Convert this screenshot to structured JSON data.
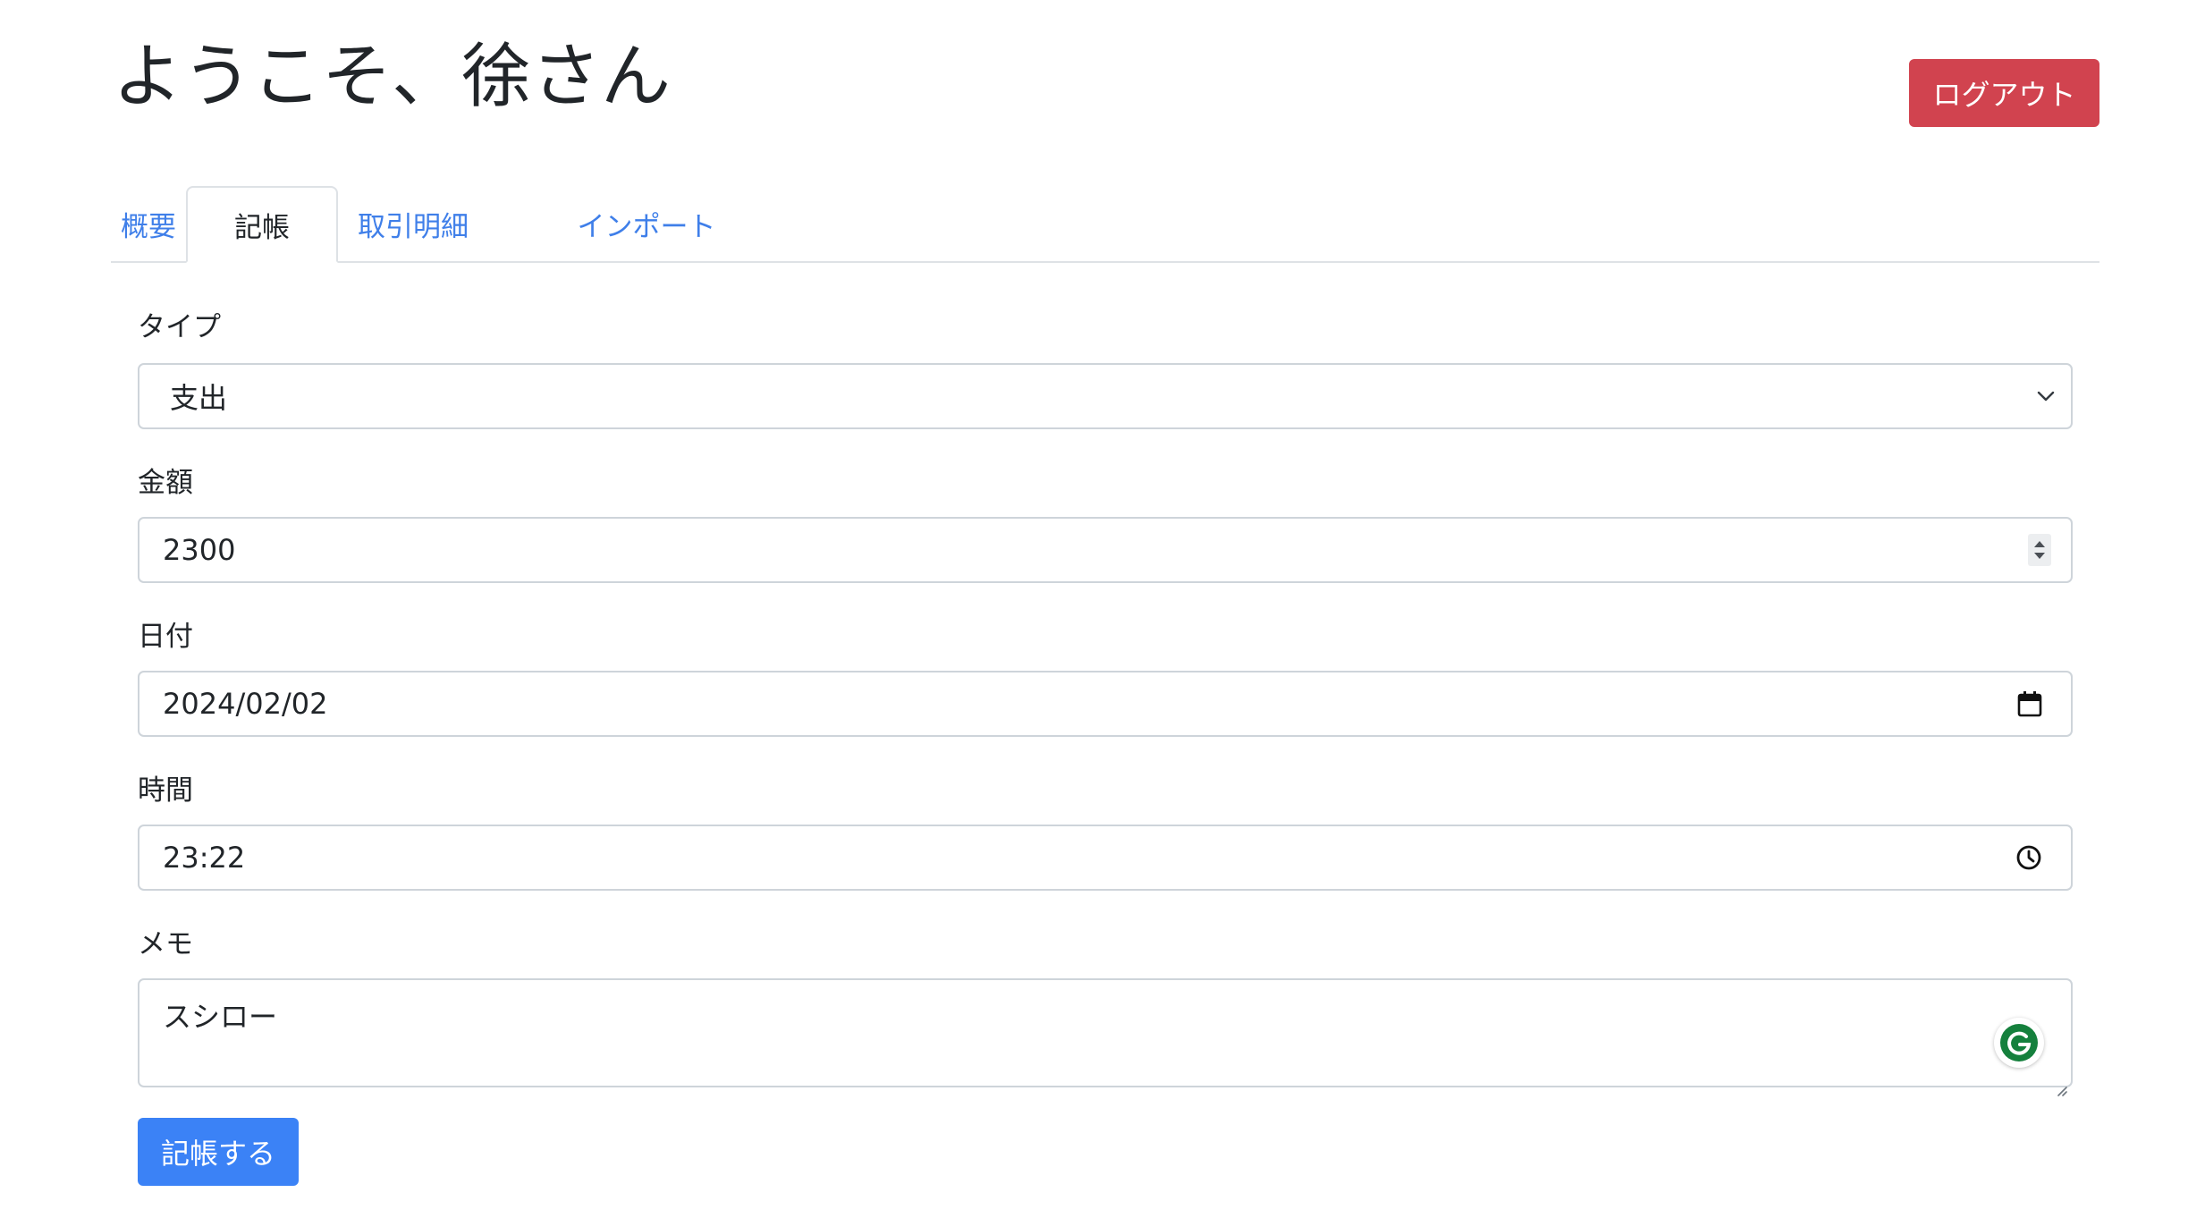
{
  "header": {
    "title": "ようこそ、徐さん",
    "logout_label": "ログアウト",
    "logout_color": "#d1434f"
  },
  "tabs": [
    {
      "label": "概要",
      "active": false
    },
    {
      "label": "記帳",
      "active": true
    },
    {
      "label": "取引明細",
      "active": false
    },
    {
      "label": "インポート",
      "active": false
    }
  ],
  "form": {
    "type": {
      "label": "タイプ",
      "value": "支出",
      "icon": "chevron-down-icon"
    },
    "amount": {
      "label": "金額",
      "value": "2300",
      "icon": "spinner-icon"
    },
    "date": {
      "label": "日付",
      "value": "2024/02/02",
      "icon": "calendar-icon"
    },
    "time": {
      "label": "時間",
      "value": "23:22",
      "icon": "clock-icon"
    },
    "memo": {
      "label": "メモ",
      "value": "スシロー",
      "icon": "grammarly-icon"
    },
    "submit_label": "記帳する",
    "submit_color": "#3b82f6"
  }
}
